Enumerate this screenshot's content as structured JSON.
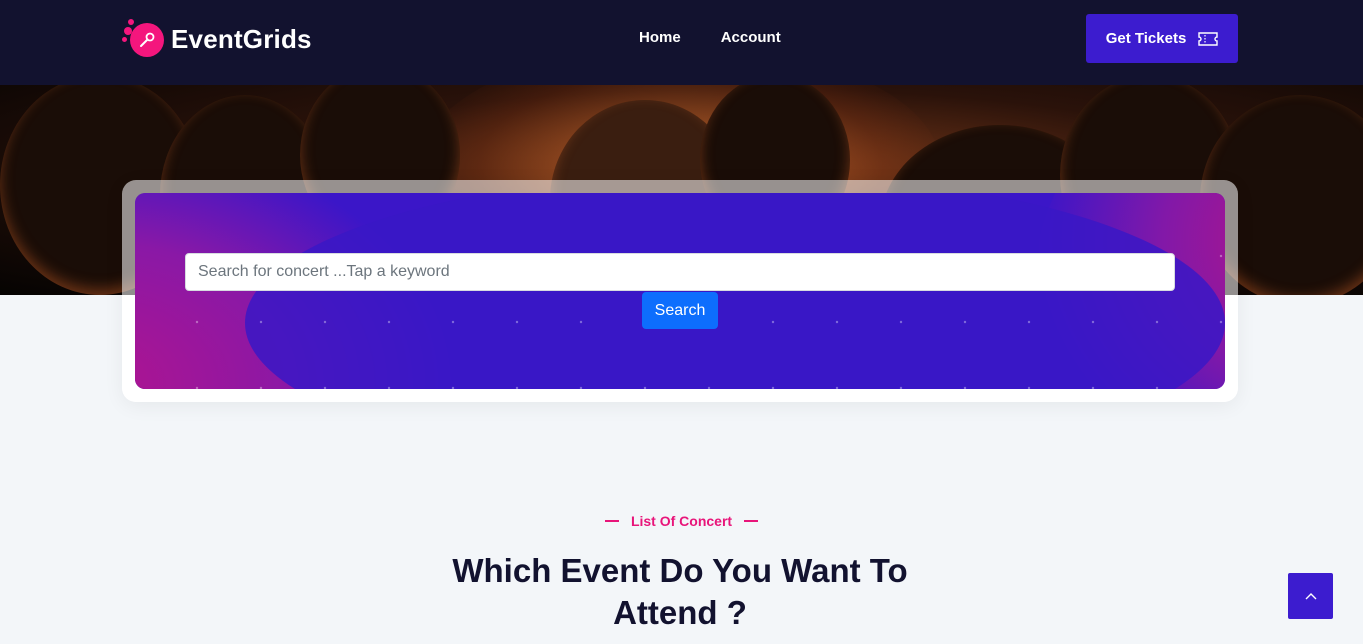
{
  "brand": {
    "name": "EventGrids",
    "accent": "#f4167d"
  },
  "nav": {
    "items": [
      "Home",
      "Account"
    ]
  },
  "header": {
    "cta_label": "Get Tickets",
    "cta_icon": "ticket-icon",
    "background": "#12122f",
    "cta_color": "#3c1ccf"
  },
  "search": {
    "placeholder": "Search for concert ...Tap a keyword",
    "value": "",
    "button_label": "Search",
    "button_color": "#0d6efd"
  },
  "section": {
    "eyebrow": "List Of Concert",
    "title": "Which Event Do You Want To Attend ?",
    "eyebrow_color": "#e8157a"
  },
  "scroll_top": {
    "icon": "chevron-up-icon"
  }
}
